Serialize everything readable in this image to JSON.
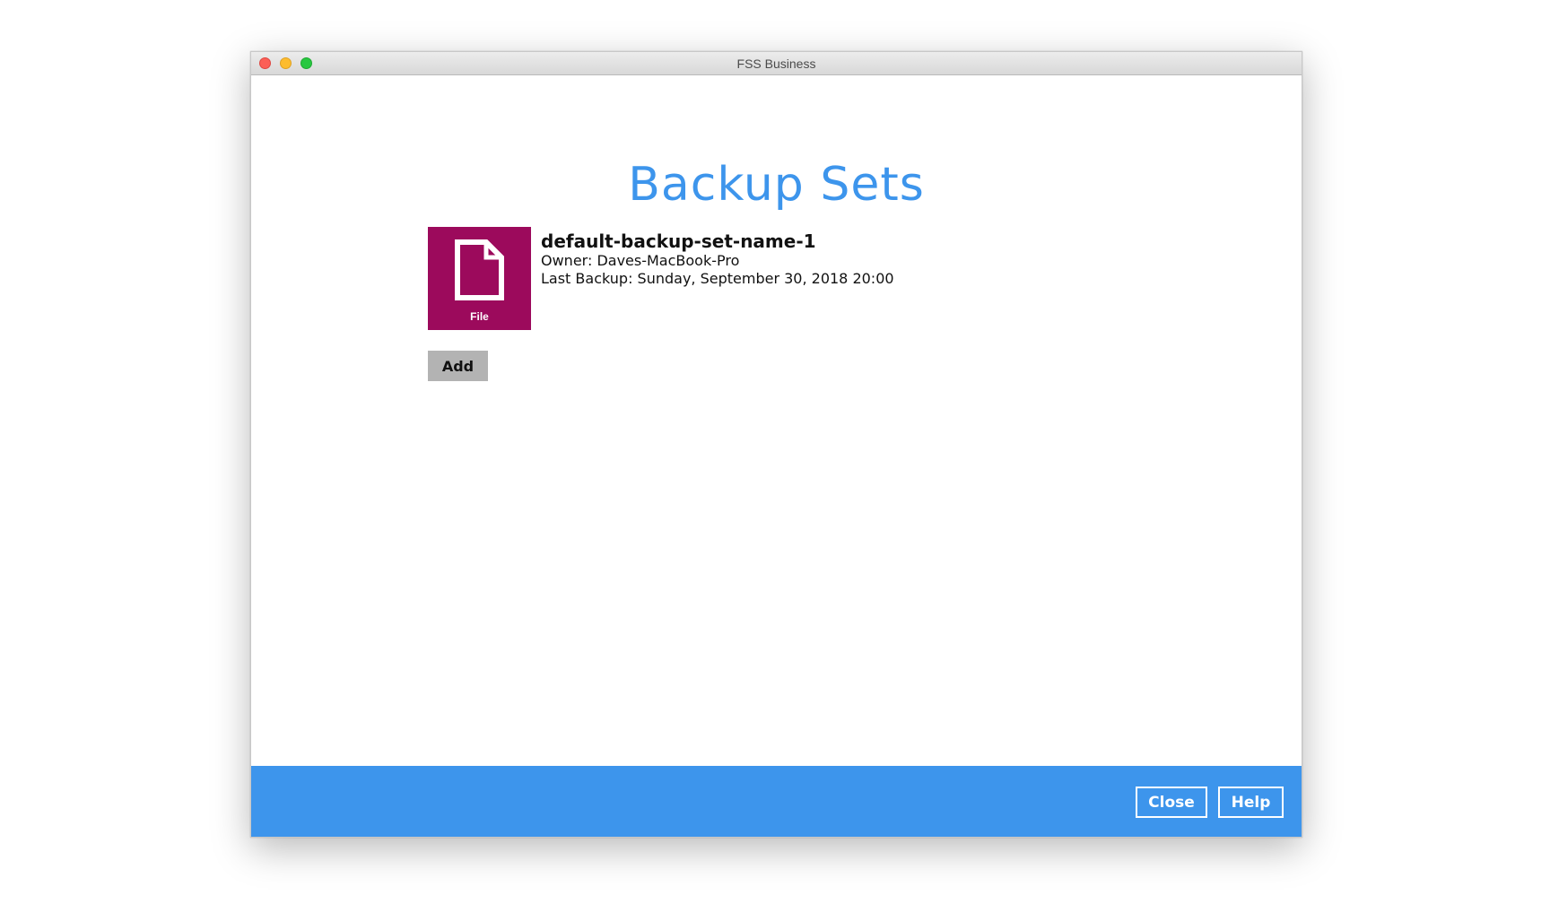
{
  "window": {
    "title": "FSS Business"
  },
  "page": {
    "title": "Backup Sets"
  },
  "backup_sets": [
    {
      "type_label": "File",
      "name": "default-backup-set-name-1",
      "owner": "Owner: Daves-MacBook-Pro",
      "last_backup": "Last Backup: Sunday, September 30, 2018 20:00",
      "icon": "file-icon",
      "tile_color": "#9c0a5c"
    }
  ],
  "actions": {
    "add_label": "Add"
  },
  "footer": {
    "close_label": "Close",
    "help_label": "Help",
    "accent_color": "#3d95ec"
  }
}
